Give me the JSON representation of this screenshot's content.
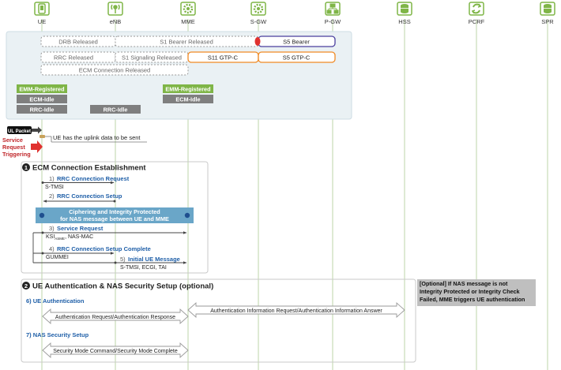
{
  "entities": [
    {
      "label": "UE",
      "icon": "phone-icon"
    },
    {
      "label": "eNB",
      "icon": "antenna-icon"
    },
    {
      "label": "MME",
      "icon": "gear-icon"
    },
    {
      "label": "S-GW",
      "icon": "gear-icon"
    },
    {
      "label": "P-GW",
      "icon": "network-icon"
    },
    {
      "label": "HSS",
      "icon": "database-icon"
    },
    {
      "label": "PCRF",
      "icon": "refresh-icon"
    },
    {
      "label": "SPR",
      "icon": "database-icon"
    }
  ],
  "initial_state": {
    "drb_released": "DRB Released",
    "s1_bearer_released": "S1 Bearer Released",
    "s5_bearer": "S5 Bearer",
    "rrc_released": "RRC  Released",
    "s1_signaling_released": "S1 Signaling Released",
    "s11_gtpc": "S11 GTP-C",
    "s5_gtpc": "S5 GTP-C",
    "ecm_connection_released": "ECM Connection Released",
    "ue_states": [
      "EMM-Registered",
      "ECM-Idle",
      "RRC-Idle"
    ],
    "enb_state": "RRC-Idle",
    "mme_states": [
      "EMM-Registered",
      "ECM-Idle"
    ]
  },
  "trigger": {
    "ul_packet": "UL Packet",
    "uplink_note": "UE has the uplink data to be sent",
    "service_request_triggering": "Service Request Triggering"
  },
  "section1": {
    "number": "1",
    "title": "ECM Connection Establishment",
    "step1_num": "1)",
    "step1_title": "RRC Connection Request",
    "step1_param": "S-TMSI",
    "step2_num": "2)",
    "step2_title": "RRC Connection Setup",
    "cipher_line1": "Ciphering and Integrity Protected",
    "cipher_line2": "for NAS message between UE and MME",
    "step3_num": "3)",
    "step3_title": "Service Request",
    "step3_param_prefix": "KSI",
    "step3_param_sub": "ASME",
    "step3_param_suffix": ", NAS-MAC",
    "step4_num": "4)",
    "step4_title": "RRC Connection Setup Complete",
    "step4_param": "GUMMEI",
    "step5_num": "5)",
    "step5_title": "Initial UE Message",
    "step5_param": "S-TMSI, ECGI, TAI"
  },
  "section2": {
    "number": "2",
    "title": "UE Authentication & NAS Security Setup (optional)",
    "step6": "6) UE Authentication",
    "auth_req_resp": "Authentication Request/Authentication Response",
    "auth_info": "Authentication Information Request/Authentication Information Answer",
    "step7": "7) NAS Security Setup",
    "smc": "Security Mode Command/Security Mode Complete",
    "optional_note": "[Optional] If NAS message is not Integrity Protected or Integrity Check Failed, MME triggers UE authentication"
  },
  "colors": {
    "green": "#7fb547",
    "gray_state": "#7f7f7f",
    "blue_title": "#1f5fa8",
    "teal_box": "#6aa6c8",
    "red": "#e0312f",
    "orange": "#f08a24",
    "purple": "#4b3f9e",
    "panel_bg": "#eaf1f4"
  }
}
